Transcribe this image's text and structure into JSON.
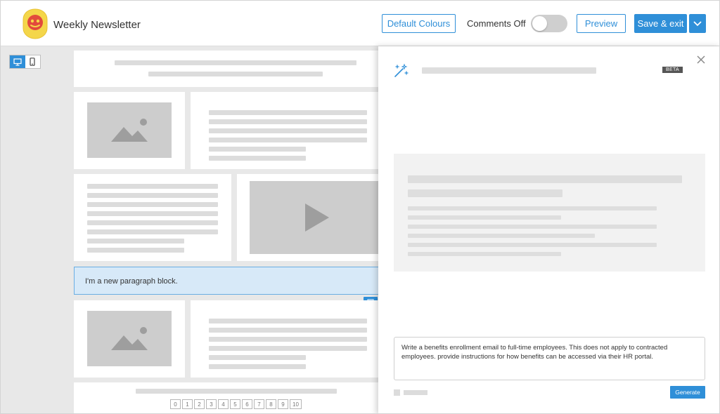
{
  "header": {
    "title": "Weekly Newsletter",
    "default_colours_label": "Default Colours",
    "comments_label": "Comments Off",
    "comments_enabled": false,
    "preview_label": "Preview",
    "save_exit_label": "Save & exit"
  },
  "canvas": {
    "device_toggle": [
      "desktop-icon",
      "mobile-icon"
    ],
    "active_device": "desktop",
    "paragraph_text": "I'm a new paragraph block.",
    "pager": [
      "0",
      "1",
      "2",
      "3",
      "4",
      "5",
      "6",
      "7",
      "8",
      "9",
      "10"
    ]
  },
  "panel": {
    "beta_label": "BETA",
    "prompt_text": "Write a benefits enrollment email to full-time employees. This does not apply to contracted employees. provide instructions for how benefits can be accessed via their HR portal.",
    "generate_label": "Generate"
  },
  "colors": {
    "accent": "#2f8fd8",
    "paragraph_highlight": "#d7e9f8",
    "placeholder": "#cdcdcd",
    "canvas_bg": "#e8e8e8"
  }
}
